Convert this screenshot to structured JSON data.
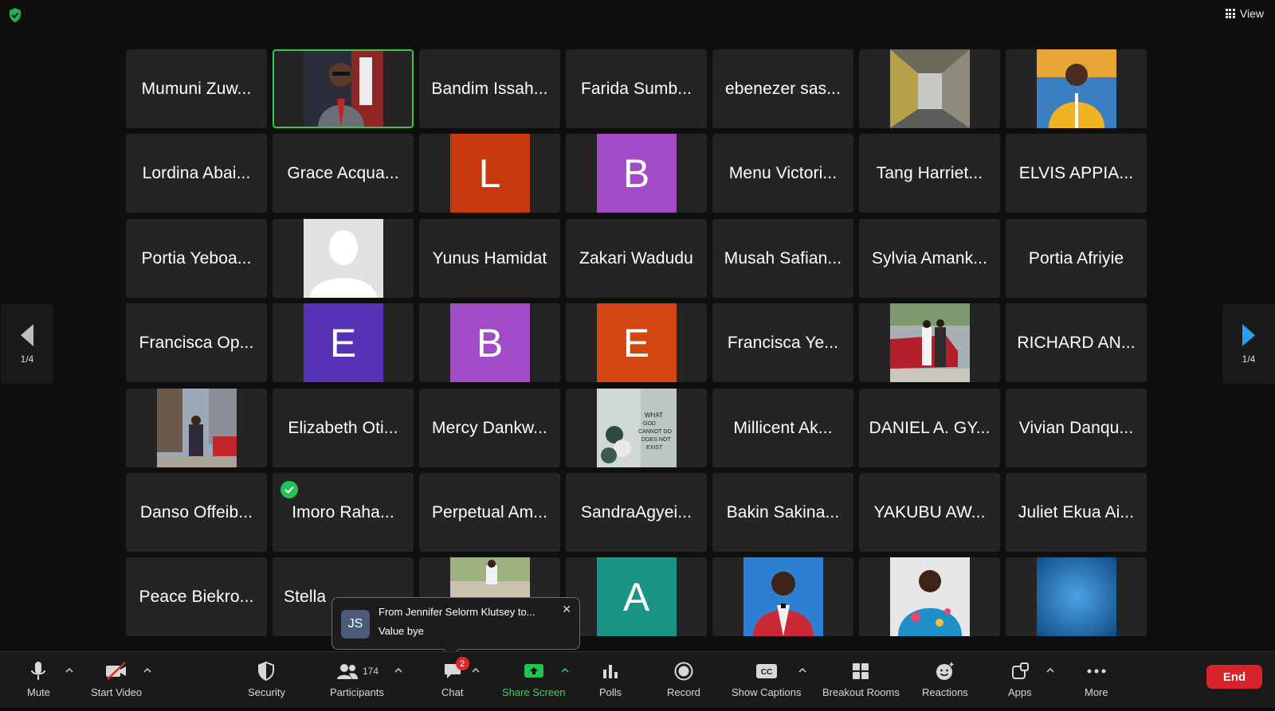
{
  "topbar": {
    "view_label": "View"
  },
  "colors": {
    "accent_green": "#35c84a",
    "end_red": "#d9232b",
    "nav_blue": "#2a9df4"
  },
  "gallery": {
    "tiles": [
      {
        "kind": "name",
        "name": "Mumuni Zuw..."
      },
      {
        "kind": "photo",
        "photo": "man-suit-studio",
        "active": true
      },
      {
        "kind": "name",
        "name": "Bandim Issah..."
      },
      {
        "kind": "name",
        "name": "Farida Sumb..."
      },
      {
        "kind": "name",
        "name": "ebenezer sas..."
      },
      {
        "kind": "photo",
        "photo": "hallway"
      },
      {
        "kind": "photo",
        "photo": "man-yellow-shirt"
      },
      {
        "kind": "name",
        "name": "Lordina Abai..."
      },
      {
        "kind": "name",
        "name": "Grace Acqua..."
      },
      {
        "kind": "letter",
        "letter": "L",
        "color": "#c8380f"
      },
      {
        "kind": "letter",
        "letter": "B",
        "color": "#a24bc6"
      },
      {
        "kind": "name",
        "name": "Menu Victori..."
      },
      {
        "kind": "name",
        "name": "Tang Harriet..."
      },
      {
        "kind": "name",
        "name": "ELVIS APPIA..."
      },
      {
        "kind": "name",
        "name": "Portia Yeboa..."
      },
      {
        "kind": "photo",
        "photo": "default-silhouette"
      },
      {
        "kind": "name",
        "name": "Yunus Hamidat"
      },
      {
        "kind": "name",
        "name": "Zakari Wadudu"
      },
      {
        "kind": "name",
        "name": "Musah Safian..."
      },
      {
        "kind": "name",
        "name": "Sylvia Amank..."
      },
      {
        "kind": "name",
        "name": "Portia Afriyie"
      },
      {
        "kind": "name",
        "name": "Francisca Op..."
      },
      {
        "kind": "letter",
        "letter": "E",
        "color": "#5632b8"
      },
      {
        "kind": "letter",
        "letter": "B",
        "color": "#a24bc6"
      },
      {
        "kind": "letter",
        "letter": "E",
        "color": "#d2470f"
      },
      {
        "kind": "name",
        "name": "Francisca Ye..."
      },
      {
        "kind": "photo",
        "photo": "people-by-red-car"
      },
      {
        "kind": "name",
        "name": "RICHARD AN..."
      },
      {
        "kind": "photo",
        "photo": "woman-city-street"
      },
      {
        "kind": "name",
        "name": "Elizabeth Oti..."
      },
      {
        "kind": "name",
        "name": "Mercy Dankw..."
      },
      {
        "kind": "photo",
        "photo": "balloons-wall-text"
      },
      {
        "kind": "name",
        "name": "Millicent  Ak..."
      },
      {
        "kind": "name",
        "name": "DANIEL A. GY..."
      },
      {
        "kind": "name",
        "name": "Vivian Danqu..."
      },
      {
        "kind": "name",
        "name": "Danso Offeib..."
      },
      {
        "kind": "name",
        "name": "Imoro  Raha...",
        "check": true
      },
      {
        "kind": "name",
        "name": "Perpetual Am..."
      },
      {
        "kind": "name",
        "name": "SandraAgyei..."
      },
      {
        "kind": "name",
        "name": "Bakin Sakina..."
      },
      {
        "kind": "name",
        "name": "YAKUBU AW..."
      },
      {
        "kind": "name",
        "name": "Juliet Ekua Ai..."
      },
      {
        "kind": "name",
        "name": "Peace Biekro..."
      },
      {
        "kind": "name",
        "name": "Stella",
        "partial": true
      },
      {
        "kind": "photo",
        "photo": "person-outdoor"
      },
      {
        "kind": "letter",
        "letter": "A",
        "color": "#1a9583"
      },
      {
        "kind": "photo",
        "photo": "man-red-blazer"
      },
      {
        "kind": "photo",
        "photo": "woman-blue-dress"
      },
      {
        "kind": "photo",
        "photo": "blue-texture"
      }
    ]
  },
  "nav": {
    "left_page": "1/4",
    "right_page": "1/4"
  },
  "toast": {
    "initials": "JS",
    "from": "From Jennifer Selorm Klutsey to...",
    "message": "Value bye",
    "close": "✕"
  },
  "toolbar": {
    "mute": "Mute",
    "start_video": "Start Video",
    "security": "Security",
    "participants": "Participants",
    "participants_count": "174",
    "chat": "Chat",
    "chat_badge": "2",
    "share_screen": "Share Screen",
    "polls": "Polls",
    "record": "Record",
    "show_captions": "Show Captions",
    "breakout_rooms": "Breakout Rooms",
    "reactions": "Reactions",
    "apps": "Apps",
    "more": "More",
    "end": "End"
  }
}
